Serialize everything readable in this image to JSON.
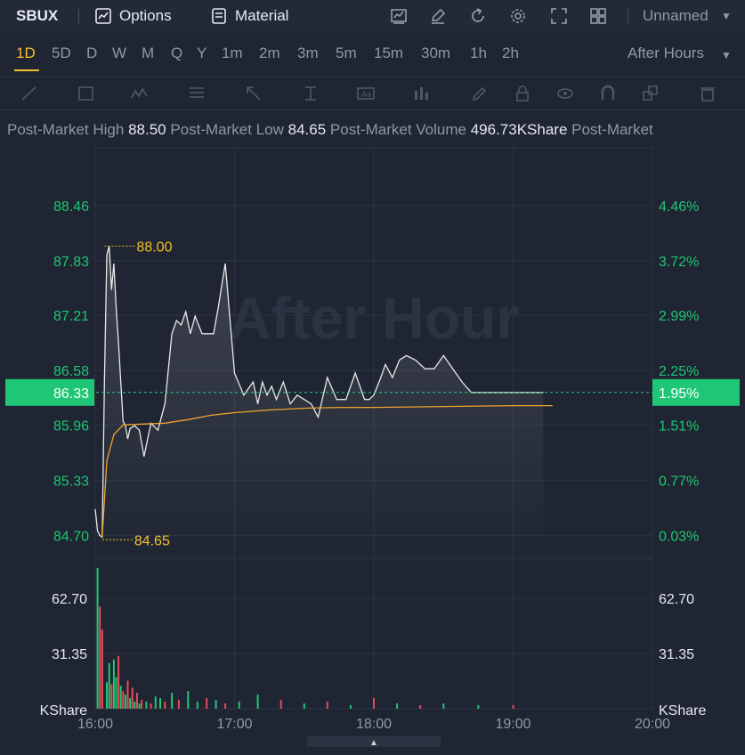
{
  "header": {
    "symbol": "SBUX",
    "options_label": "Options",
    "material_label": "Material",
    "layout_name": "Unnamed"
  },
  "periods": [
    "1D",
    "5D",
    "D",
    "W",
    "M",
    "Q",
    "Y",
    "1m",
    "2m",
    "3m",
    "5m",
    "15m",
    "30m",
    "1h",
    "2h"
  ],
  "active_period": "1D",
  "session_select": "After Hours",
  "stats": [
    {
      "label": "Post-Market High",
      "value": "88.50"
    },
    {
      "label": "Post-Market Low",
      "value": "84.65"
    },
    {
      "label": "Post-Market Volume",
      "value": "496.73KShare"
    },
    {
      "label": "Post-Market",
      "value": ""
    }
  ],
  "watermark": "After Hour",
  "colors": {
    "up": "#1ec675",
    "down": "#e84b5a",
    "avg_line": "#f0a22e",
    "price_line": "#e8e8e8",
    "accent": "#f2c12e"
  },
  "chart_data": {
    "type": "line",
    "session": "After Hours",
    "x_ticks": [
      "16:00",
      "17:00",
      "18:00",
      "19:00",
      "20:00"
    ],
    "x_range": [
      "16:00",
      "20:00"
    ],
    "y_ticks_left": [
      "88.46",
      "87.83",
      "87.21",
      "86.58",
      "85.96",
      "85.33",
      "84.70"
    ],
    "y_ticks_right": [
      "4.46%",
      "3.72%",
      "2.99%",
      "2.25%",
      "1.51%",
      "0.77%",
      "0.03%"
    ],
    "ylim": [
      84.46,
      89.12
    ],
    "current_price": "86.33",
    "current_change": "1.95%",
    "annotations": [
      {
        "label": "88.00",
        "time": "16:04",
        "price": 88.0
      },
      {
        "label": "84.65",
        "time": "16:03",
        "price": 84.65
      }
    ],
    "price": {
      "time": [
        "16:00",
        "16:01",
        "16:02",
        "16:03",
        "16:04",
        "16:05",
        "16:06",
        "16:07",
        "16:08",
        "16:09",
        "16:10",
        "16:12",
        "16:13",
        "16:14",
        "16:15",
        "16:17",
        "16:19",
        "16:21",
        "16:24",
        "16:27",
        "16:30",
        "16:33",
        "16:35",
        "16:37",
        "16:39",
        "16:41",
        "16:43",
        "16:46",
        "16:48",
        "16:51",
        "16:53",
        "16:56",
        "17:00",
        "17:04",
        "17:08",
        "17:10",
        "17:12",
        "17:14",
        "17:16",
        "17:18",
        "17:21",
        "17:24",
        "17:27",
        "17:30",
        "17:33",
        "17:36",
        "17:40",
        "17:44",
        "17:48",
        "17:52",
        "17:56",
        "17:58",
        "18:00",
        "18:03",
        "18:05",
        "18:08",
        "18:11",
        "18:14",
        "18:18",
        "18:22",
        "18:26",
        "18:30",
        "18:34",
        "18:38",
        "18:42",
        "18:45",
        "18:48",
        "18:52",
        "18:56",
        "19:00",
        "19:03",
        "19:06",
        "19:09",
        "19:11",
        "19:13"
      ],
      "price": [
        85.0,
        84.75,
        84.7,
        84.68,
        86.5,
        87.9,
        88.0,
        87.5,
        87.8,
        87.3,
        86.9,
        86.0,
        85.95,
        85.8,
        85.92,
        85.95,
        85.9,
        85.6,
        85.98,
        85.9,
        86.2,
        87.0,
        87.15,
        87.1,
        87.25,
        87.0,
        87.2,
        87.0,
        87.0,
        87.0,
        87.3,
        87.8,
        86.55,
        86.3,
        86.45,
        86.2,
        86.45,
        86.3,
        86.4,
        86.25,
        86.45,
        86.2,
        86.3,
        86.25,
        86.2,
        86.05,
        86.5,
        86.25,
        86.25,
        86.55,
        86.25,
        86.25,
        86.3,
        86.5,
        86.65,
        86.5,
        86.7,
        86.75,
        86.7,
        86.6,
        86.6,
        86.75,
        86.6,
        86.45,
        86.33,
        86.33,
        86.33,
        86.33,
        86.33,
        86.33,
        86.33,
        86.33,
        86.33,
        86.33,
        86.33
      ]
    },
    "average": {
      "time": [
        "16:03",
        "16:05",
        "16:08",
        "16:12",
        "16:20",
        "16:30",
        "16:40",
        "16:50",
        "17:00",
        "17:15",
        "17:30",
        "17:45",
        "18:00",
        "18:30",
        "19:00",
        "19:17"
      ],
      "price": [
        84.68,
        85.55,
        85.85,
        85.96,
        85.97,
        85.98,
        86.02,
        86.07,
        86.1,
        86.13,
        86.15,
        86.16,
        86.16,
        86.17,
        86.18,
        86.18
      ]
    },
    "volume": {
      "unit": "KShare",
      "y_ticks": [
        "62.70",
        "31.35"
      ],
      "ylim": [
        0,
        85
      ],
      "time": [
        "16:01",
        "16:02",
        "16:03",
        "16:05",
        "16:06",
        "16:07",
        "16:08",
        "16:09",
        "16:10",
        "16:11",
        "16:12",
        "16:13",
        "16:14",
        "16:15",
        "16:16",
        "16:17",
        "16:18",
        "16:19",
        "16:20",
        "16:22",
        "16:24",
        "16:26",
        "16:28",
        "16:30",
        "16:33",
        "16:36",
        "16:40",
        "16:44",
        "16:48",
        "16:52",
        "16:56",
        "17:02",
        "17:10",
        "17:20",
        "17:30",
        "17:40",
        "17:50",
        "18:00",
        "18:10",
        "18:20",
        "18:30",
        "18:45",
        "19:00"
      ],
      "values": [
        80,
        58,
        45,
        15,
        26,
        14,
        28,
        18,
        30,
        13,
        10,
        8,
        16,
        6,
        12,
        4,
        9,
        3,
        5,
        4,
        3,
        7,
        6,
        4,
        9,
        5,
        10,
        4,
        6,
        5,
        3,
        4,
        8,
        5,
        3,
        4,
        2,
        6,
        3,
        2,
        3,
        2,
        2
      ],
      "direction": [
        "up",
        "down",
        "down",
        "up",
        "up",
        "down",
        "up",
        "up",
        "down",
        "up",
        "down",
        "up",
        "down",
        "up",
        "down",
        "up",
        "down",
        "up",
        "down",
        "up",
        "down",
        "up",
        "up",
        "down",
        "up",
        "down",
        "up",
        "up",
        "down",
        "up",
        "down",
        "up",
        "up",
        "down",
        "up",
        "down",
        "up",
        "down",
        "up",
        "down",
        "up",
        "up",
        "down"
      ]
    }
  }
}
